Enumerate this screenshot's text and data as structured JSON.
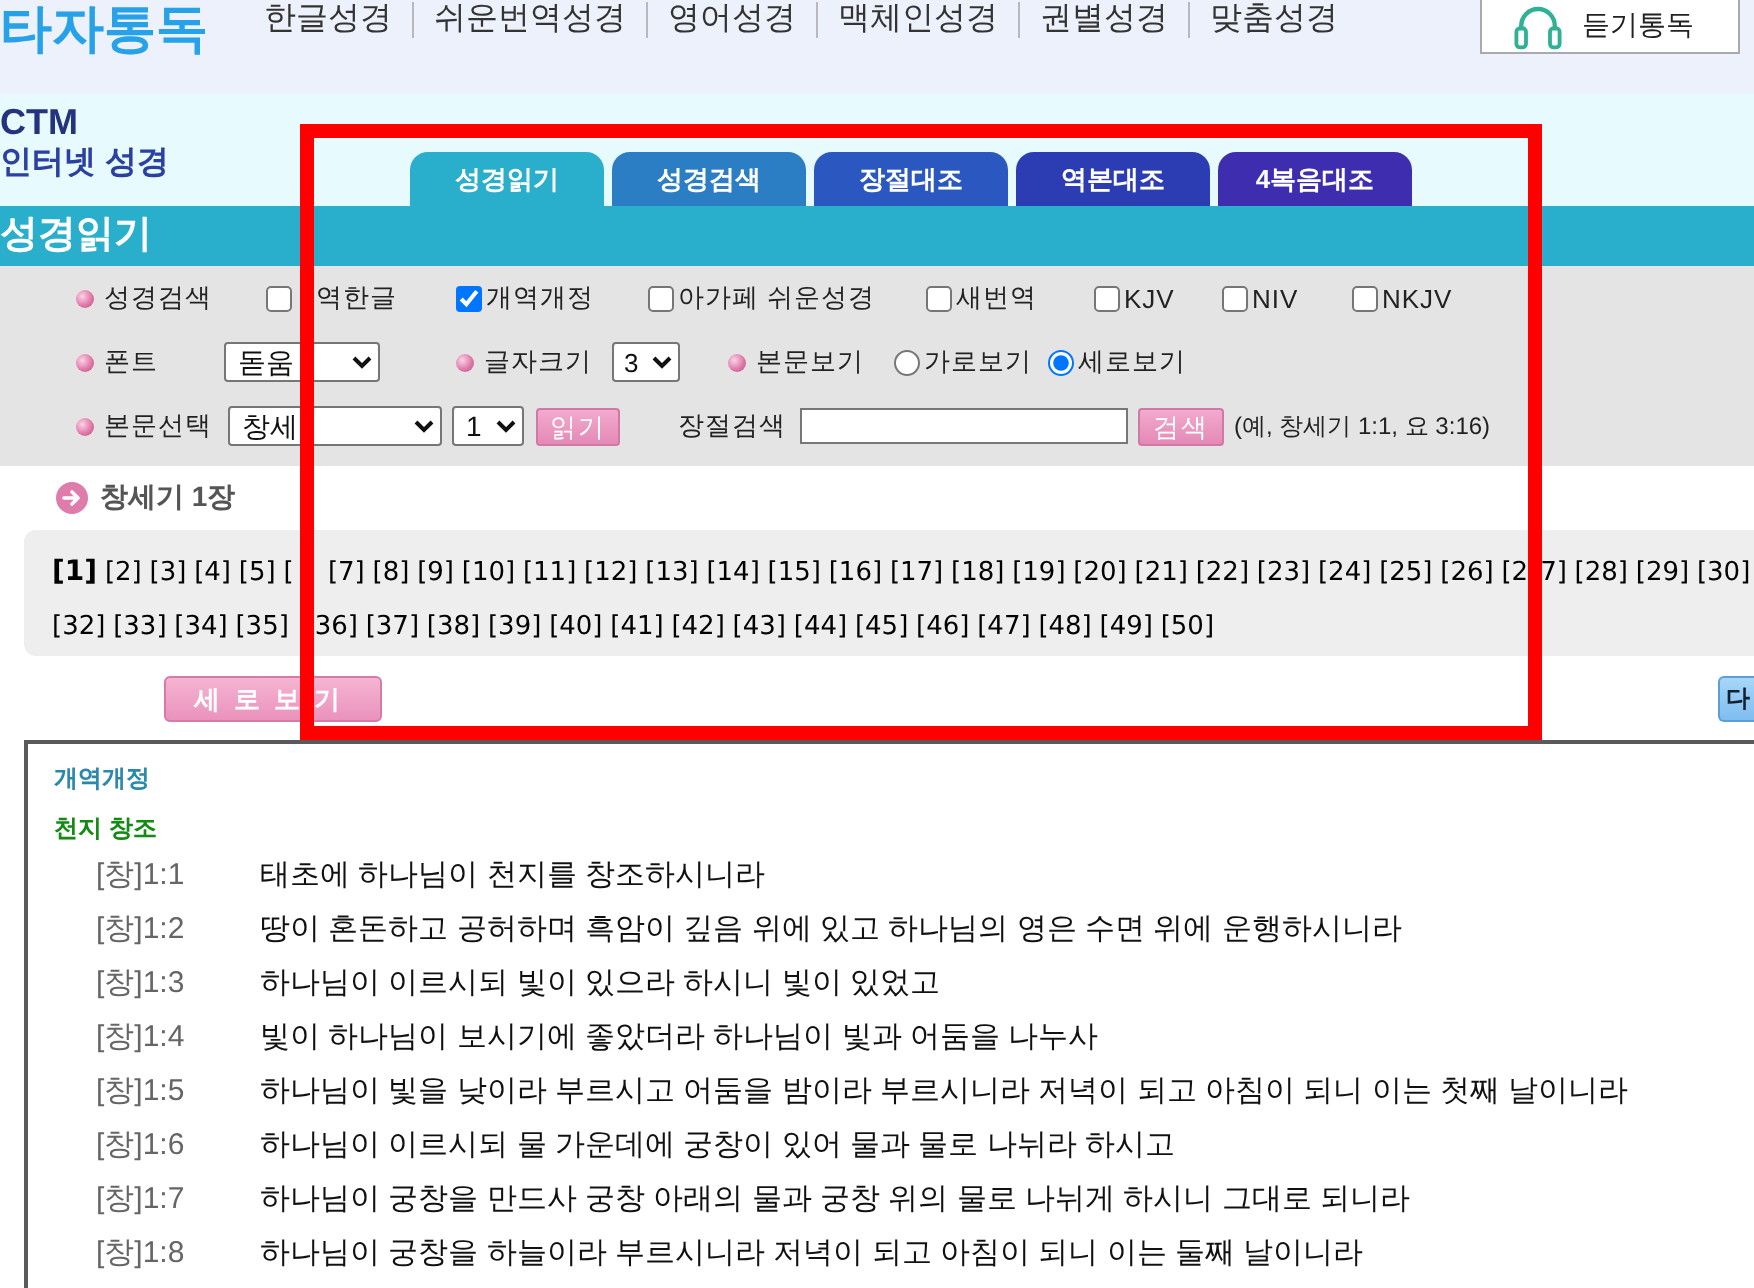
{
  "header": {
    "logo": "타자통독",
    "nav": [
      "한글성경",
      "쉬운번역성경",
      "영어성경",
      "맥체인성경",
      "권별성경",
      "맞춤성경"
    ],
    "audio_button": "듣기통독"
  },
  "brand": {
    "name": "CTM",
    "subtitle": "인터넷 성경"
  },
  "tabs": [
    {
      "label": "성경읽기",
      "selected": true
    },
    {
      "label": "성경검색",
      "selected": false
    },
    {
      "label": "장절대조",
      "selected": false
    },
    {
      "label": "역본대조",
      "selected": false
    },
    {
      "label": "4복음대조",
      "selected": false
    }
  ],
  "section_title": "성경읽기",
  "options": {
    "versions": {
      "label": "성경검색",
      "items": [
        {
          "kind": "covered",
          "label": "역한글",
          "checked": false
        },
        {
          "kind": "plain",
          "label": "개역개정",
          "checked": true
        },
        {
          "kind": "plain",
          "label": "아가페 쉬운성경",
          "checked": false
        },
        {
          "kind": "plain",
          "label": "새번역",
          "checked": false
        },
        {
          "kind": "plain",
          "label": "KJV",
          "checked": false
        },
        {
          "kind": "plain",
          "label": "NIV",
          "checked": false
        },
        {
          "kind": "plain",
          "label": "NKJV",
          "checked": false
        }
      ]
    },
    "font": {
      "label": "폰트",
      "value": "돋움"
    },
    "font_size": {
      "label": "글자크기",
      "value": "3"
    },
    "view": {
      "label": "본문보기",
      "options": [
        {
          "label": "가로보기",
          "selected": false
        },
        {
          "label": "세로보기",
          "selected": true
        }
      ]
    },
    "passage": {
      "label": "본문선택",
      "book": "창세",
      "chapter": "1",
      "button": "읽기"
    },
    "verse_search": {
      "label": "장절검색",
      "button": "검색",
      "hint": "(예, 창세기 1:1, 요 3:16)"
    }
  },
  "current_title": "창세기 1장",
  "chapter_rows": [
    [
      {
        "kind": "link",
        "label": "[1]",
        "selected": true
      },
      {
        "kind": "link",
        "label": "[2]",
        "selected": false
      },
      {
        "kind": "link",
        "label": "[3]",
        "selected": false
      },
      {
        "kind": "link",
        "label": "[4]",
        "selected": false
      },
      {
        "kind": "link",
        "label": "[5]",
        "selected": false
      },
      {
        "kind": "covered",
        "before": "[",
        "selected": false
      },
      {
        "kind": "link",
        "label": "[7]",
        "selected": false
      },
      {
        "kind": "link",
        "label": "[8]",
        "selected": false
      },
      {
        "kind": "link",
        "label": "[9]",
        "selected": false
      },
      {
        "kind": "link",
        "label": "[10]",
        "selected": false
      },
      {
        "kind": "link",
        "label": "[11]",
        "selected": false
      },
      {
        "kind": "link",
        "label": "[12]",
        "selected": false
      },
      {
        "kind": "link",
        "label": "[13]",
        "selected": false
      },
      {
        "kind": "link",
        "label": "[14]",
        "selected": false
      },
      {
        "kind": "link",
        "label": "[15]",
        "selected": false
      },
      {
        "kind": "link",
        "label": "[16]",
        "selected": false
      },
      {
        "kind": "link",
        "label": "[17]",
        "selected": false
      },
      {
        "kind": "link",
        "label": "[18]",
        "selected": false
      },
      {
        "kind": "link",
        "label": "[19]",
        "selected": false
      },
      {
        "kind": "link",
        "label": "[20]",
        "selected": false
      },
      {
        "kind": "link",
        "label": "[21]",
        "selected": false
      },
      {
        "kind": "link",
        "label": "[22]",
        "selected": false
      },
      {
        "kind": "link",
        "label": "[23]",
        "selected": false
      },
      {
        "kind": "link",
        "label": "[24]",
        "selected": false
      },
      {
        "kind": "link",
        "label": "[25]",
        "selected": false
      },
      {
        "kind": "link",
        "label": "[26]",
        "selected": false
      },
      {
        "kind": "covered",
        "before": "[2",
        "after": "7]",
        "selected": false
      },
      {
        "kind": "link",
        "label": "[28]",
        "selected": false
      },
      {
        "kind": "link",
        "label": "[29]",
        "selected": false
      },
      {
        "kind": "link",
        "label": "[30]",
        "selected": false
      }
    ],
    [
      {
        "kind": "link",
        "label": "[32]",
        "selected": false
      },
      {
        "kind": "link",
        "label": "[33]",
        "selected": false
      },
      {
        "kind": "link",
        "label": "[34]",
        "selected": false
      },
      {
        "kind": "link",
        "label": "[35]",
        "selected": false
      },
      {
        "kind": "covered",
        "after": "36]",
        "selected": false
      },
      {
        "kind": "link",
        "label": "[37]",
        "selected": false
      },
      {
        "kind": "link",
        "label": "[38]",
        "selected": false
      },
      {
        "kind": "link",
        "label": "[39]",
        "selected": false
      },
      {
        "kind": "link",
        "label": "[40]",
        "selected": false
      },
      {
        "kind": "link",
        "label": "[41]",
        "selected": false
      },
      {
        "kind": "link",
        "label": "[42]",
        "selected": false
      },
      {
        "kind": "link",
        "label": "[43]",
        "selected": false
      },
      {
        "kind": "link",
        "label": "[44]",
        "selected": false
      },
      {
        "kind": "link",
        "label": "[45]",
        "selected": false
      },
      {
        "kind": "link",
        "label": "[46]",
        "selected": false
      },
      {
        "kind": "link",
        "label": "[47]",
        "selected": false
      },
      {
        "kind": "link",
        "label": "[48]",
        "selected": false
      },
      {
        "kind": "link",
        "label": "[49]",
        "selected": false
      },
      {
        "kind": "link",
        "label": "[50]",
        "selected": false
      }
    ]
  ],
  "view_button": "세로보기",
  "next_button": "다",
  "reader": {
    "version": "개역개정",
    "heading": "천지 창조",
    "verses": [
      {
        "ref": "[창]1:1",
        "text": "태초에 하나님이 천지를 창조하시니라"
      },
      {
        "ref": "[창]1:2",
        "text": "땅이 혼돈하고 공허하며 흑암이 깊음 위에 있고 하나님의 영은 수면 위에 운행하시니라"
      },
      {
        "ref": "[창]1:3",
        "text": "하나님이 이르시되 빛이 있으라 하시니 빛이 있었고"
      },
      {
        "ref": "[창]1:4",
        "text": "빛이 하나님이 보시기에 좋았더라 하나님이 빛과 어둠을 나누사"
      },
      {
        "ref": "[창]1:5",
        "text": "하나님이 빛을 낮이라 부르시고 어둠을 밤이라 부르시니라 저녁이 되고 아침이 되니 이는 첫째 날이니라"
      },
      {
        "ref": "[창]1:6",
        "text": "하나님이 이르시되 물 가운데에 궁창이 있어 물과 물로 나뉘라 하시고"
      },
      {
        "ref": "[창]1:7",
        "text": "하나님이 궁창을 만드사 궁창 아래의 물과 궁창 위의 물로 나뉘게 하시니 그대로 되니라"
      },
      {
        "ref": "[창]1:8",
        "text": "하나님이 궁창을 하늘이라 부르시니라 저녁이 되고 아침이 되니 이는 둘째 날이니라"
      }
    ]
  }
}
